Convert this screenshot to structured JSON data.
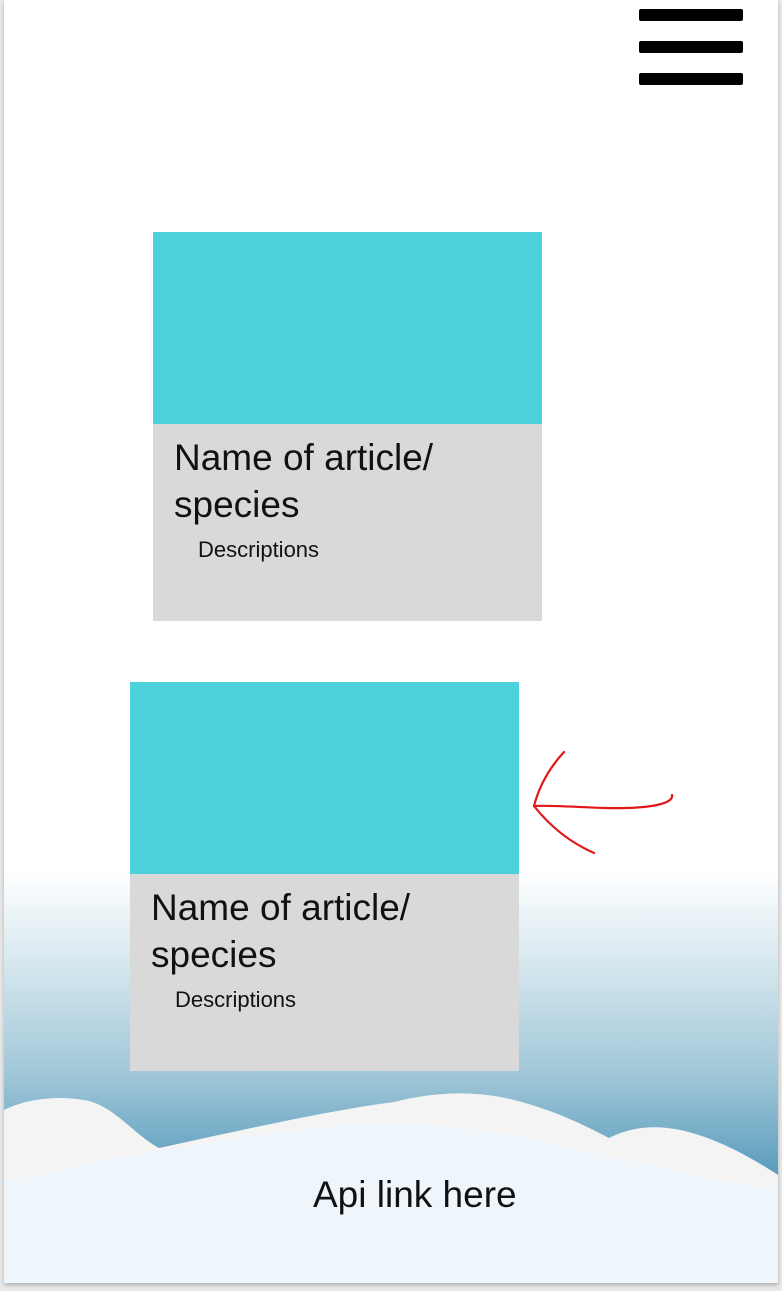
{
  "menu": {
    "icon": "hamburger-menu-icon"
  },
  "cards": [
    {
      "title": "Name of article/ species",
      "description": "Descriptions",
      "image_color": "#4dd2db"
    },
    {
      "title": "Name of article/ species",
      "description": "Descriptions",
      "image_color": "#4dd2db"
    }
  ],
  "annotation": {
    "icon": "hand-drawn-arrow-icon",
    "color": "#e01818"
  },
  "footer": {
    "api_link_label": "Api link here"
  },
  "colors": {
    "card_image": "#4dd2db",
    "card_body": "#d9d9d9",
    "sea_deep": "#2f80a8",
    "snow": "#eef5fb"
  }
}
